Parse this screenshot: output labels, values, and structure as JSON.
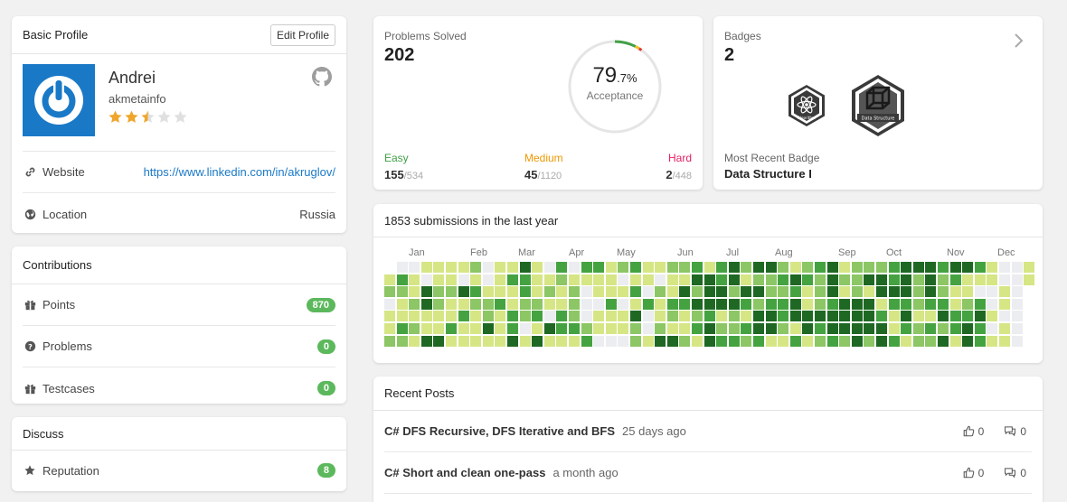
{
  "basic_profile": {
    "header": "Basic Profile",
    "edit_button": "Edit Profile",
    "name": "Andrei",
    "username": "akmetainfo",
    "stars": 2.5,
    "website_label": "Website",
    "website_url": "https://www.linkedin.com/in/akruglov/",
    "location_label": "Location",
    "location_value": "Russia"
  },
  "contributions": {
    "header": "Contributions",
    "items": [
      {
        "label": "Points",
        "value": "870",
        "icon": "gift-icon"
      },
      {
        "label": "Problems",
        "value": "0",
        "icon": "question-circle-icon"
      },
      {
        "label": "Testcases",
        "value": "0",
        "icon": "gift-icon"
      }
    ]
  },
  "discuss": {
    "header": "Discuss",
    "items": [
      {
        "label": "Reputation",
        "value": "8",
        "icon": "star-icon"
      }
    ]
  },
  "problems": {
    "label": "Problems Solved",
    "solved": "202",
    "acceptance_int": "79",
    "acceptance_dec": ".7%",
    "acceptance_label": "Acceptance",
    "acceptance_fraction": 0.797,
    "easy": {
      "label": "Easy",
      "solved": "155",
      "total": "/534",
      "color": "#43a047"
    },
    "medium": {
      "label": "Medium",
      "solved": "45",
      "total": "/1120",
      "color": "#ef9800"
    },
    "hard": {
      "label": "Hard",
      "solved": "2",
      "total": "/448",
      "color": "#e91e63"
    }
  },
  "badges": {
    "label": "Badges",
    "count": "2",
    "recent_label": "Most Recent Badge",
    "recent_name": "Data Structure I",
    "small_badge_text": "Algorithm",
    "large_badge_text": "Data Structure"
  },
  "submissions": {
    "title": "1853 submissions in the last year",
    "months": [
      "Jan",
      "Feb",
      "Mar",
      "Apr",
      "May",
      "Jun",
      "Jul",
      "Aug",
      "Sep",
      "Oct",
      "Nov",
      "Dec"
    ],
    "colors": [
      "#ebedf0",
      "#d6e685",
      "#8cc665",
      "#44a340",
      "#1e6823"
    ]
  },
  "recent_posts": {
    "header": "Recent Posts",
    "items": [
      {
        "title": "C# DFS Recursive, DFS Iterative and BFS",
        "when": "25 days ago",
        "likes": "0",
        "comments": "0"
      },
      {
        "title": "C# Short and clean one-pass",
        "when": "a month ago",
        "likes": "0",
        "comments": "0"
      }
    ]
  }
}
